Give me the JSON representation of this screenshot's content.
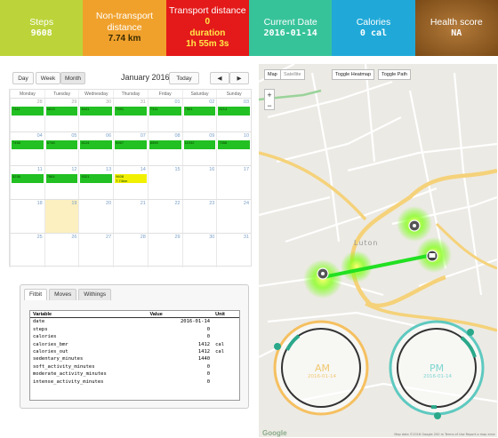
{
  "tiles": {
    "steps": {
      "title": "Steps",
      "value": "9608"
    },
    "non_transport": {
      "title1": "Non-transport",
      "title2": "distance",
      "value": "7.74 km"
    },
    "transport": {
      "title": "Transport distance",
      "value1": "0",
      "value2": "duration",
      "value3": "1h 55m 3s"
    },
    "date": {
      "title": "Current Date",
      "value": "2016-01-14"
    },
    "calories": {
      "title": "Calories",
      "value": "0 cal"
    },
    "health": {
      "title": "Health score",
      "value": "NA"
    }
  },
  "calendar": {
    "views": [
      "Day",
      "Week",
      "Month"
    ],
    "title": "January 2016",
    "today_label": "Today",
    "prev": "◀",
    "next": "▶",
    "dow": [
      "Monday",
      "Tuesday",
      "Wednesday",
      "Thursday",
      "Friday",
      "Saturday",
      "Sunday"
    ],
    "weeks": [
      [
        "28",
        "29",
        "30",
        "31",
        "01",
        "02",
        "03"
      ],
      [
        "04",
        "05",
        "06",
        "07",
        "08",
        "09",
        "10"
      ],
      [
        "11",
        "12",
        "13",
        "14",
        "15",
        "16",
        "17"
      ],
      [
        "18",
        "19",
        "20",
        "21",
        "22",
        "23",
        "24"
      ],
      [
        "25",
        "26",
        "27",
        "28",
        "29",
        "30",
        "31"
      ]
    ],
    "events": {
      "w0": [
        "7311",
        "6613",
        "8441",
        "7591",
        "7311",
        "7551",
        "6214"
      ],
      "w1": [
        "7456",
        "6748",
        "6124",
        "6967",
        "8559",
        "11932",
        "7356"
      ],
      "w2": [
        "5236",
        "7864",
        "9321"
      ],
      "w2_today": "9608",
      "w2_today_sub": "7.74km"
    }
  },
  "panel": {
    "tabs": [
      "Fitbit",
      "Moves",
      "Withings"
    ],
    "headers": [
      "Variable",
      "Value",
      "Unit"
    ],
    "rows": [
      [
        "date",
        "2016-01-14",
        ""
      ],
      [
        "steps",
        "0",
        ""
      ],
      [
        "calories",
        "0",
        ""
      ],
      [
        "calories_bmr",
        "1412",
        "cal"
      ],
      [
        "calories_out",
        "1412",
        "cal"
      ],
      [
        "sedentary_minutes",
        "1440",
        ""
      ],
      [
        "soft_activity_minutes",
        "0",
        ""
      ],
      [
        "moderate_activity_minutes",
        "0",
        ""
      ],
      [
        "intense_activity_minutes",
        "0",
        ""
      ]
    ]
  },
  "map": {
    "types": [
      "Map",
      "Satellite"
    ],
    "toggle_heatmap": "Toggle Heatmap",
    "toggle_path": "Toggle Path",
    "zoom_in": "+",
    "zoom_out": "−",
    "town": "Luton",
    "am_label": "AM",
    "am_date": "2016-01-14",
    "pm_label": "PM",
    "pm_date": "2016-01-14",
    "google": "Google",
    "footer": "Map data ©2016 Google  200 m  Terms of Use  Report a map error"
  }
}
